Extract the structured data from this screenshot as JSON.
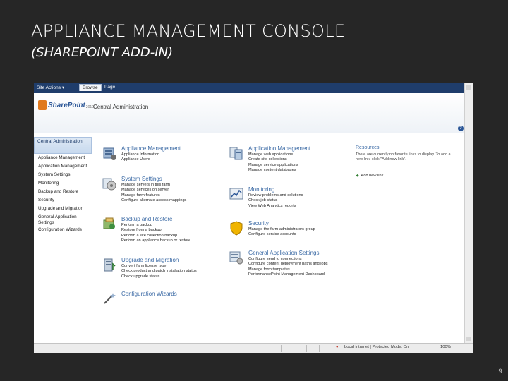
{
  "slide": {
    "title": "APPLIANCE MANAGEMENT CONSOLE",
    "subtitle": "(SHAREPOINT ADD-IN)",
    "page_number": "9"
  },
  "ribbon": {
    "site_actions": "Site Actions ▾",
    "browse_tab": "Browse",
    "page_tab": "Page"
  },
  "header": {
    "logo_word": "SharePoint",
    "logo_year": "2010",
    "site_title": "Central Administration",
    "help": "?"
  },
  "left_nav": {
    "heading": "Central Administration",
    "items": [
      "Appliance Management",
      "Application Management",
      "System Settings",
      "Monitoring",
      "Backup and Restore",
      "Security",
      "Upgrade and Migration",
      "General Application Settings",
      "Configuration Wizards"
    ]
  },
  "sections": [
    {
      "title": "Appliance Management",
      "links": [
        "Appliance Information",
        "Appliance Users"
      ]
    },
    {
      "title": "System Settings",
      "links": [
        "Manage servers in this farm",
        "Manage services on server",
        "Manage farm features",
        "Configure alternate access mappings"
      ]
    },
    {
      "title": "Backup and Restore",
      "links": [
        "Perform a backup",
        "Restore from a backup",
        "Perform a site collection backup",
        "Perform an appliance backup or restore"
      ]
    },
    {
      "title": "Upgrade and Migration",
      "links": [
        "Convert farm license type",
        "Check product and patch installation status",
        "Check upgrade status"
      ]
    },
    {
      "title": "Configuration Wizards",
      "links": []
    },
    {
      "title": "Application Management",
      "links": [
        "Manage web applications",
        "Create site collections",
        "Manage service applications",
        "Manage content databases"
      ]
    },
    {
      "title": "Monitoring",
      "links": [
        "Review problems and solutions",
        "Check job status",
        "View Web Analytics reports"
      ]
    },
    {
      "title": "Security",
      "links": [
        "Manage the farm administrators group",
        "Configure service accounts"
      ]
    },
    {
      "title": "General Application Settings",
      "links": [
        "Configure send to connections",
        "Configure content deployment paths and jobs",
        "Manage form templates",
        "PerformancePoint Management Dashboard"
      ]
    }
  ],
  "resources": {
    "title": "Resources",
    "text": "There are currently no favorite links to display. To add a new link, click \"Add new link\".",
    "add_link": "Add new link"
  },
  "status_bar": {
    "zone": "Local intranet | Protected Mode: On",
    "zoom": "100%"
  },
  "colors": {
    "slide_background": "#262626",
    "ribbon": "#1f3d6b",
    "section_title": "#3b6aa5"
  }
}
